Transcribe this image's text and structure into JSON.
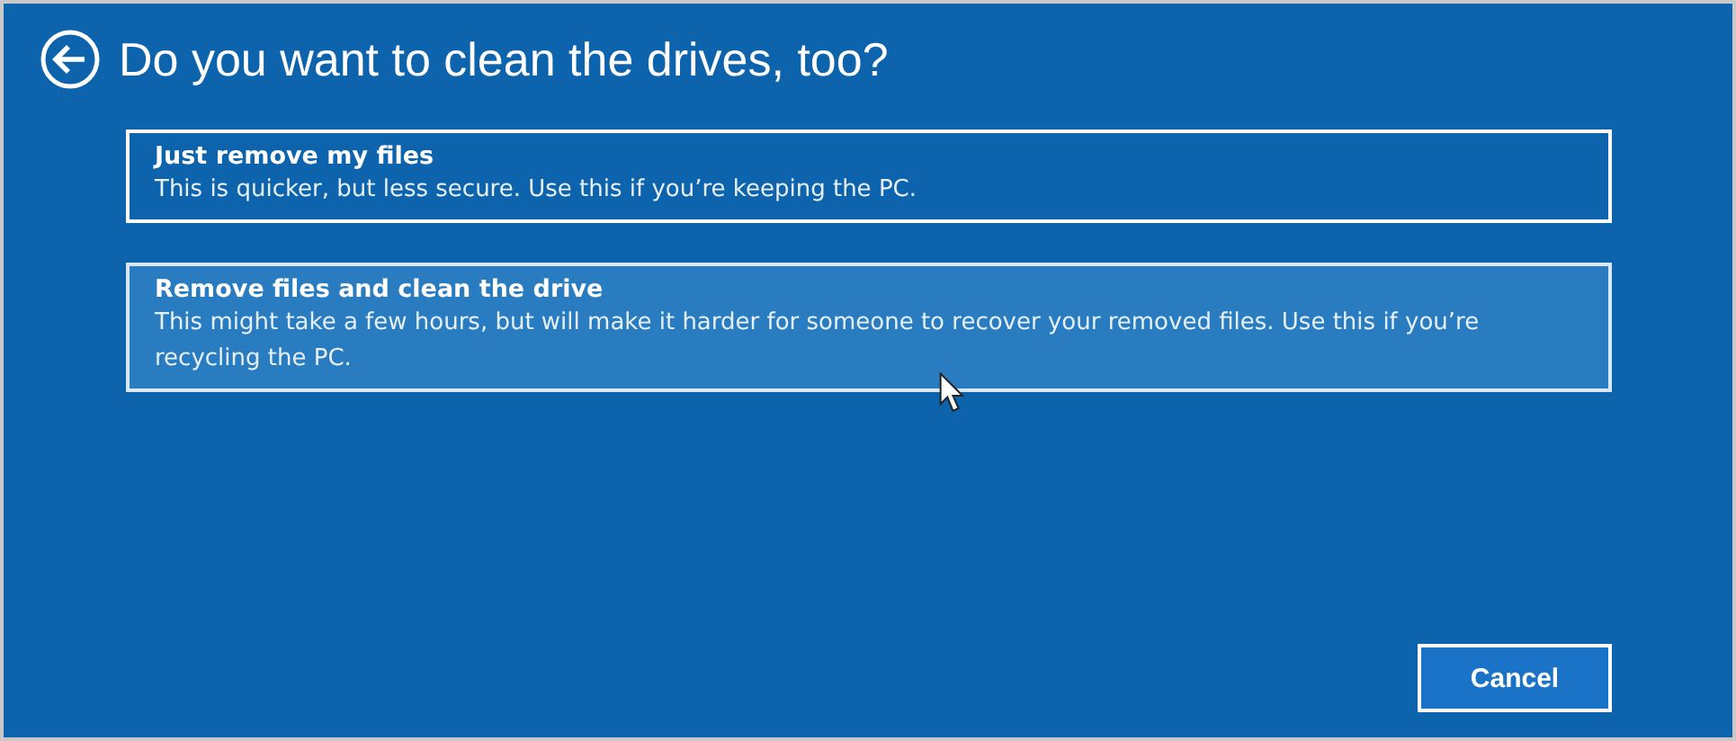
{
  "title": "Do you want to clean the drives, too?",
  "options": [
    {
      "title": "Just remove my files",
      "description": "This is quicker, but less secure. Use this if you’re keeping the PC.",
      "hovered": false
    },
    {
      "title": "Remove files and clean the drive",
      "description": "This might take a few hours, but will make it harder for someone to recover your removed files. Use this if you’re recycling the PC.",
      "hovered": true
    }
  ],
  "buttons": [
    "Cancel"
  ]
}
